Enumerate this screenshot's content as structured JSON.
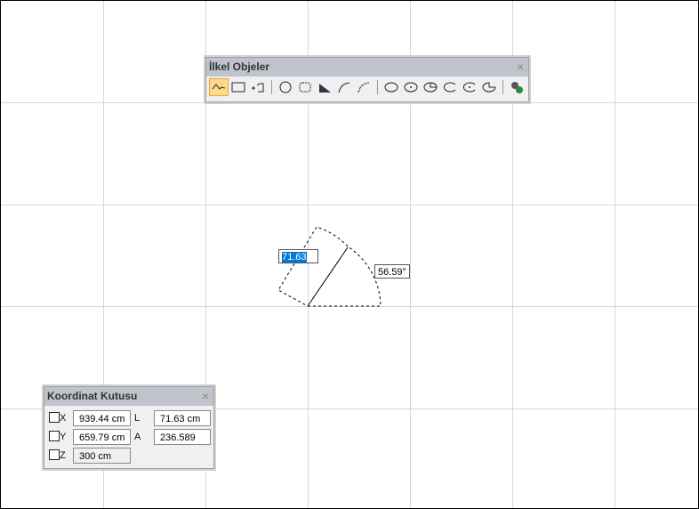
{
  "toolbar": {
    "title": "İlkel Objeler",
    "close": "×",
    "tools": [
      "polyline-icon",
      "rectangle-icon",
      "polyline-add-icon",
      "circle-icon",
      "cloud-icon",
      "triangle-icon",
      "arc-icon",
      "arc-arrow-icon",
      "ellipse-icon",
      "ellipse-center-icon",
      "pie-icon",
      "ellipse-arc-icon",
      "ellipse-arc-center-icon",
      "pie-segment-icon",
      "settings-gears-icon"
    ]
  },
  "drawing": {
    "length_input": "71.63",
    "angle_label": "56.59°"
  },
  "coord_box": {
    "title": "Koordinat Kutusu",
    "close": "×",
    "x_label": "X",
    "x_value": "939.44 cm",
    "y_label": "Y",
    "y_value": "659.79 cm",
    "z_label": "Z",
    "z_value": "300 cm",
    "l_label": "L",
    "l_value": "71.63 cm",
    "a_label": "A",
    "a_value": "236.589"
  },
  "colors": {
    "grid": "#d4d6e6",
    "selection": "#0078d7",
    "active_tool": "#ffd98a"
  }
}
